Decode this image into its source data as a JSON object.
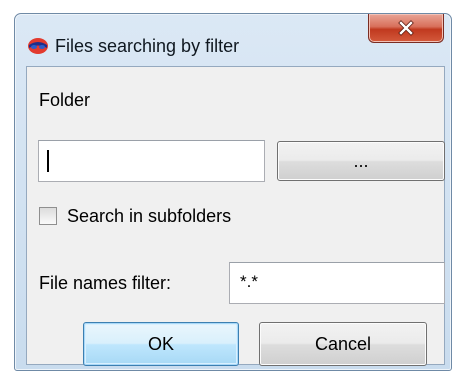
{
  "window": {
    "title": "Files searching by filter",
    "app_icon": "app-logo-icon",
    "close_icon": "close-icon"
  },
  "folder": {
    "label": "Folder",
    "value": "",
    "browse_label": "..."
  },
  "subfolders": {
    "label": "Search in subfolders",
    "checked": false
  },
  "filter": {
    "label": "File names filter:",
    "value": "*.*"
  },
  "buttons": {
    "ok_label": "OK",
    "cancel_label": "Cancel"
  },
  "colors": {
    "close_button": "#c0391f",
    "title_gradient_top": "#dbe8f5",
    "content_bg": "#f0f0f0",
    "default_button_border": "#3c7fb1"
  }
}
